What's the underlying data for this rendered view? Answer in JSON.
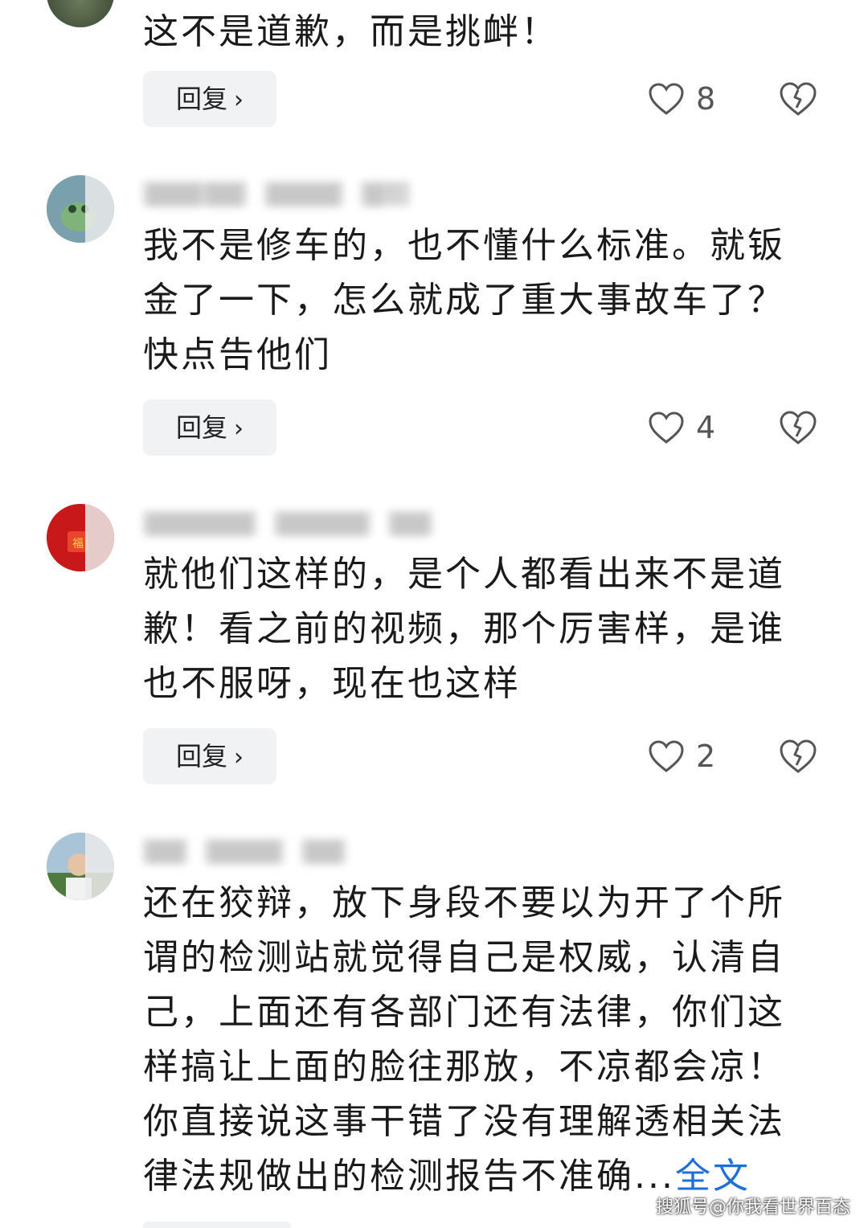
{
  "comments": [
    {
      "text": "这不是道歉，而是挑衅！",
      "reply_label": "回复",
      "likes": "8"
    },
    {
      "meta": [
        "▇▇▇ ▇▇",
        "▇▇▇▇",
        "▇东"
      ],
      "text": "我不是修车的，也不懂什么标准。就钣\n金了一下，怎么就成了重大事故车了？\n快点告他们",
      "reply_label": "回复",
      "likes": "4"
    },
    {
      "meta": [
        "▇▇▇▇▇▇",
        "▇▇▇▇▇",
        "▇▇"
      ],
      "text": "就他们这样的，是个人都看出来不是道\n歉！看之前的视频，那个厉害样，是谁\n也不服呀，现在也这样",
      "reply_label": "回复",
      "likes": "2"
    },
    {
      "meta": [
        "▇▇",
        "▇▇▇▇",
        "▇▇"
      ],
      "text_main": "还在狡辩，放下身段不要以为开了个所\n谓的检测站就觉得自己是权威，认清自\n己，上面还有各部门还有法律，你们这\n样搞让上面的脸往那放，不凉都会凉！\n你直接说这事干错了没有理解透相关法\n律法规做出的检测报告不准确",
      "ellipsis": "...",
      "more_label": "全文"
    }
  ],
  "watermark": "搜狐号@你我看世界百态",
  "icons": {
    "like": "heart-outline-icon",
    "dislike": "broken-heart-icon",
    "reply_chevron": "chevron-right-icon"
  },
  "colors": {
    "link": "#1e6fd9",
    "button_bg": "#f1f2f4",
    "icon": "#555555"
  }
}
